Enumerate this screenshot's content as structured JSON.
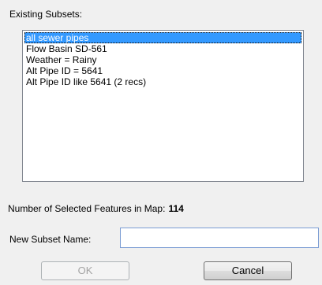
{
  "existing_subsets": {
    "label": "Existing Subsets:",
    "items": [
      {
        "label": "all sewer pipes",
        "selected": true
      },
      {
        "label": "Flow Basin SD-561",
        "selected": false
      },
      {
        "label": "Weather = Rainy",
        "selected": false
      },
      {
        "label": "Alt Pipe ID = 5641",
        "selected": false
      },
      {
        "label": "Alt Pipe ID like 5641 (2 recs)",
        "selected": false
      }
    ]
  },
  "selected_features": {
    "label": "Number of Selected Features in Map:",
    "value": "114"
  },
  "new_subset": {
    "label": "New Subset Name:",
    "value": "",
    "placeholder": ""
  },
  "buttons": {
    "ok_label": "OK",
    "ok_enabled": false,
    "cancel_label": "Cancel"
  },
  "colors": {
    "selection": "#3399ff",
    "dialog_background": "#f0f0f0"
  }
}
